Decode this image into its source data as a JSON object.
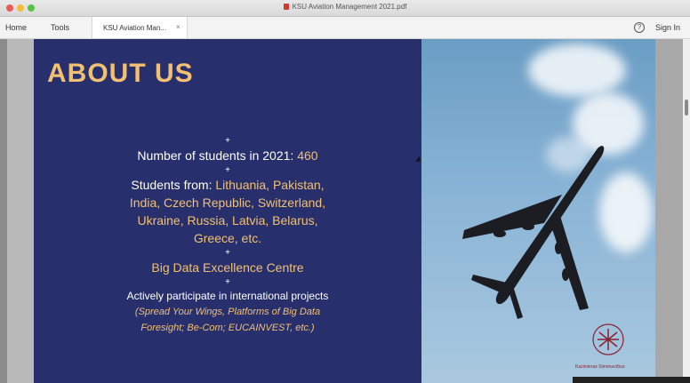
{
  "window": {
    "title": "KSU Aviation Management 2021.pdf"
  },
  "menubar": {
    "home": "Home",
    "tools": "Tools",
    "tab_label": "KSU Aviation Man...",
    "tab_close": "×",
    "help": "?",
    "sign_in": "Sign In"
  },
  "slide": {
    "title": "ABOUT US",
    "plus": "+",
    "students_label": "Number of students in 2021:",
    "students_value": "460",
    "from_label": "Students from:",
    "from_line1": "Lithuania, Pakistan,",
    "from_line2": "India, Czech Republic, Switzerland,",
    "from_line3": "Ukraine, Russia, Latvia, Belarus,",
    "from_line4": "Greece, etc.",
    "centre": "Big Data Excellence Centre",
    "projects": "Actively participate in international projects",
    "projects_line1": "(Spread Your Wings, Platforms of Big Data",
    "projects_line2": "Foresight; Be-Com; EUCAINVEST, etc.)",
    "seal_text": "Kazimieras Simonavičius"
  },
  "colors": {
    "slide_bg": "#272f6c",
    "accent": "#f1c073",
    "sky": "#8ab4d6"
  }
}
